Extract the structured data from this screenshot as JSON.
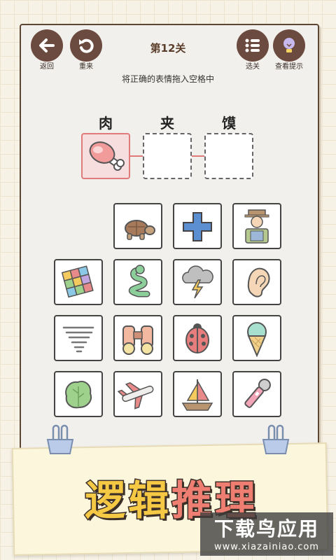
{
  "header": {
    "back_label": "返回",
    "restart_label": "重来",
    "level_label": "第12关",
    "select_level_label": "选关",
    "hint_label": "查看提示"
  },
  "instruction": "将正确的表情拖入空格中",
  "puzzle": {
    "characters": [
      "肉",
      "夹",
      "馍"
    ],
    "slots": [
      {
        "filled": true,
        "icon": "meat-icon"
      },
      {
        "filled": false,
        "icon": ""
      },
      {
        "filled": false,
        "icon": ""
      }
    ]
  },
  "tiles": [
    {
      "icon": "turtle-icon"
    },
    {
      "icon": "plus-icon"
    },
    {
      "icon": "farmer-icon"
    },
    {
      "icon": "rubiks-cube-icon"
    },
    {
      "icon": "snake-icon"
    },
    {
      "icon": "thunder-cloud-icon"
    },
    {
      "icon": "ear-icon"
    },
    {
      "icon": "tornado-icon"
    },
    {
      "icon": "binoculars-icon"
    },
    {
      "icon": "ladybug-icon"
    },
    {
      "icon": "ice-cream-icon"
    },
    {
      "icon": "lettuce-icon"
    },
    {
      "icon": "airplane-icon"
    },
    {
      "icon": "sailboat-icon"
    },
    {
      "icon": "microphone-icon"
    }
  ],
  "banner": {
    "title_chars": [
      "逻",
      "辑",
      "推",
      "理"
    ],
    "title_colors": [
      "#f6c945",
      "#f6c945",
      "#ee7e72",
      "#ee7e72"
    ]
  },
  "watermark": {
    "text": "下载鸟应用",
    "url": "www.xiazainiao.com"
  },
  "colors": {
    "button_brown": "#6b4a3f",
    "slot_filled_border": "#e07b7b"
  }
}
